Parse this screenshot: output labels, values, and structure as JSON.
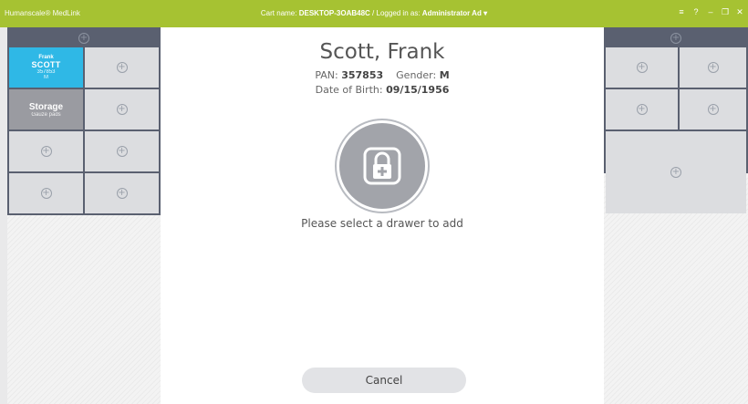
{
  "titlebar": {
    "app_name": "Humanscale® MedLink",
    "cart_label": "Cart name:",
    "cart_name": "DESKTOP-3OAB48C",
    "separator": "/",
    "logged_label": "Logged in as:",
    "user": "Administrator Ad",
    "user_caret": "▾",
    "controls": [
      "≡",
      "?",
      "–",
      "❐",
      "✕"
    ]
  },
  "left_cabinet": {
    "patient_cell": {
      "first": "Frank",
      "last": "SCOTT",
      "id": "357853",
      "sex": "M"
    },
    "storage_cell": {
      "title": "Storage",
      "sub": "Gauze pads"
    }
  },
  "patient": {
    "name": "Scott, Frank",
    "pan_label": "PAN:",
    "pan": "357853",
    "gender_label": "Gender:",
    "gender": "M",
    "dob_label": "Date of Birth:",
    "dob": "09/15/1956"
  },
  "prompt": "Please select a drawer to add",
  "cancel_label": "Cancel",
  "icons": {
    "add": "plus-circle-icon",
    "drawer": "locked-drawer-icon"
  },
  "colors": {
    "titlebar": "#a6c232",
    "patient_cell": "#2fb8e6",
    "cabinet_frame": "#5a6070",
    "storage_cell": "#9a9ba1"
  }
}
